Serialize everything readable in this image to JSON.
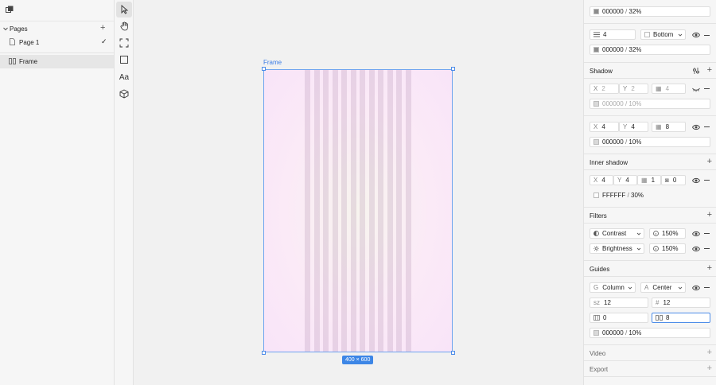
{
  "sidebar": {
    "pages_label": "Pages",
    "pages": [
      {
        "label": "Page 1",
        "selected": true
      }
    ],
    "layers": [
      {
        "label": "Frame"
      }
    ]
  },
  "toolbar": {
    "tools": [
      "pointer-tool",
      "hand-tool",
      "frame-tool",
      "rectangle-tool",
      "text-tool",
      "component-tool"
    ],
    "text_tool_label": "Aa"
  },
  "canvas": {
    "frame_label": "Frame",
    "size_label": "400 × 600",
    "guide_columns": 12
  },
  "panel": {
    "stroke1": {
      "color": "000000",
      "sep": "/",
      "opacity": "32%"
    },
    "stroke2": {
      "width": "4",
      "position": "Bottom",
      "color": "000000",
      "sep": "/",
      "opacity": "32%"
    },
    "shadow": {
      "title": "Shadow",
      "items": [
        {
          "x_label": "X",
          "x": "2",
          "y_label": "Y",
          "y": "2",
          "blur": "4",
          "color": "000000",
          "sep": "/",
          "opacity": "10%",
          "enabled": false
        },
        {
          "x_label": "X",
          "x": "4",
          "y_label": "Y",
          "y": "4",
          "blur": "8",
          "color": "000000",
          "sep": "/",
          "opacity": "10%",
          "enabled": true
        }
      ]
    },
    "inner_shadow": {
      "title": "Inner shadow",
      "x_label": "X",
      "x": "4",
      "y_label": "Y",
      "y": "4",
      "blur": "1",
      "spread": "0",
      "color": "FFFFFF",
      "sep": "/",
      "opacity": "30%"
    },
    "filters": {
      "title": "Filters",
      "items": [
        {
          "name": "Contrast",
          "value": "150%"
        },
        {
          "name": "Brightness",
          "value": "150%"
        }
      ]
    },
    "guides": {
      "title": "Guides",
      "type_prefix": "G",
      "type": "Column",
      "align_prefix": "A",
      "align": "Center",
      "size_prefix": "sz",
      "size": "12",
      "count_prefix": "#",
      "count": "12",
      "margin": "0",
      "gutter": "8",
      "color": "000000",
      "sep": "/",
      "opacity": "10%"
    },
    "video": {
      "title": "Video"
    },
    "export": {
      "title": "Export"
    }
  },
  "colors": {
    "accent": "#3d86e6",
    "selection": "#6fa4ef"
  }
}
